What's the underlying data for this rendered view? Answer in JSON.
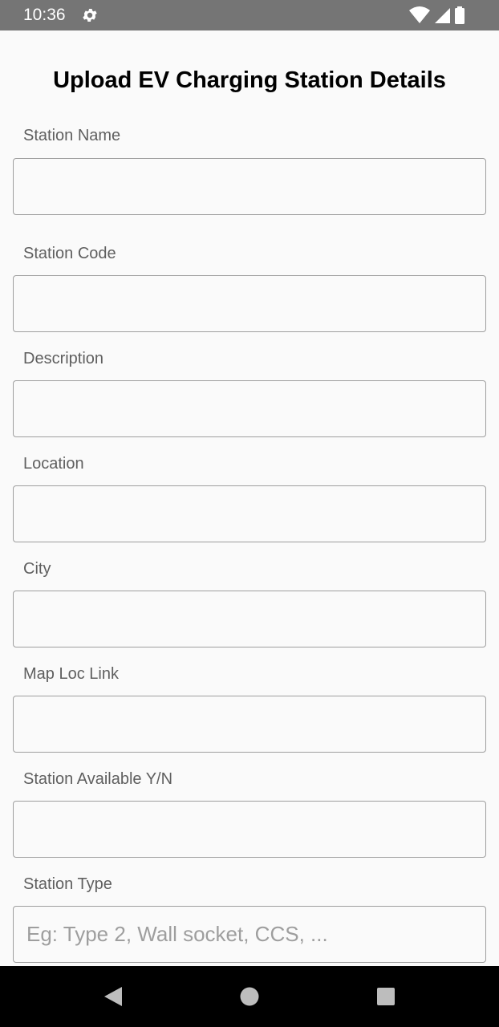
{
  "status_bar": {
    "time": "10:36",
    "icons": [
      "gear-icon",
      "wifi-icon",
      "cell-signal-icon",
      "battery-icon"
    ]
  },
  "page": {
    "title": "Upload EV Charging Station Details"
  },
  "fields": [
    {
      "label": "Station Name",
      "value": "",
      "placeholder": ""
    },
    {
      "label": "Station Code",
      "value": "",
      "placeholder": ""
    },
    {
      "label": "Description",
      "value": "",
      "placeholder": ""
    },
    {
      "label": "Location",
      "value": "",
      "placeholder": ""
    },
    {
      "label": "City",
      "value": "",
      "placeholder": ""
    },
    {
      "label": "Map Loc Link",
      "value": "",
      "placeholder": ""
    },
    {
      "label": "Station Available Y/N",
      "value": "",
      "placeholder": ""
    },
    {
      "label": "Station Type",
      "value": "",
      "placeholder": "Eg: Type 2, Wall socket, CCS, ..."
    }
  ],
  "nav_bar": {
    "icons": [
      "back-icon",
      "home-icon",
      "recents-icon"
    ]
  },
  "colors": {
    "status_bar_bg": "#757575",
    "background": "#fafafa",
    "nav_bar_bg": "#000000",
    "input_border": "#9e9e9e",
    "label_text": "#5f5f5f"
  }
}
